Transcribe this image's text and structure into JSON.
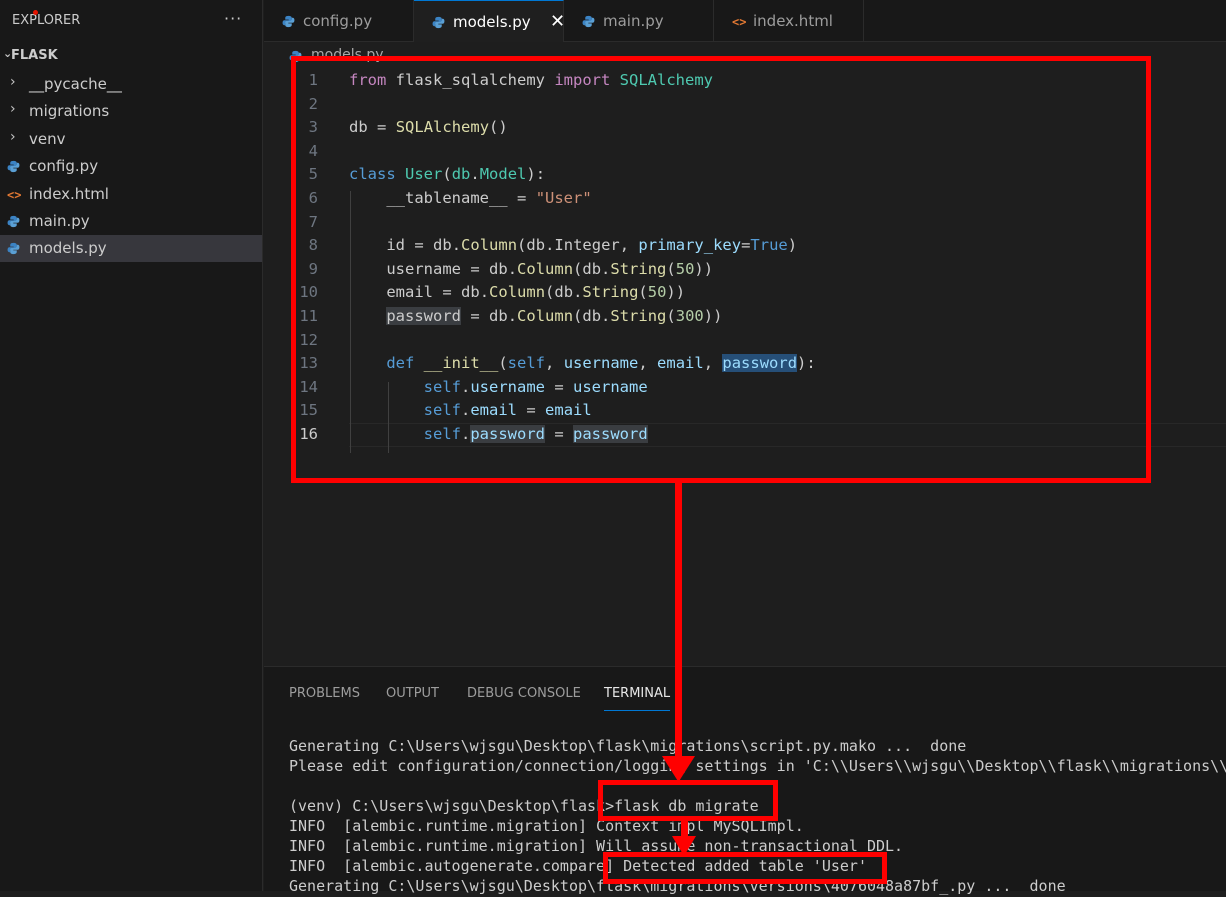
{
  "sidebar": {
    "title": "EXPLORER",
    "more": "···",
    "root_chevron": "⌄",
    "root": "FLASK",
    "items": [
      {
        "label": "__pycache__",
        "type": "folder",
        "icon": "chevron-right-icon",
        "glyph": "›"
      },
      {
        "label": "migrations",
        "type": "folder",
        "icon": "chevron-right-icon",
        "glyph": "›"
      },
      {
        "label": "venv",
        "type": "folder",
        "icon": "chevron-right-icon",
        "glyph": "›"
      },
      {
        "label": "config.py",
        "type": "file",
        "icon": "python-file-icon"
      },
      {
        "label": "index.html",
        "type": "file",
        "icon": "html-file-icon",
        "glyph": "<>"
      },
      {
        "label": "main.py",
        "type": "file",
        "icon": "python-file-icon"
      },
      {
        "label": "models.py",
        "type": "file",
        "icon": "python-file-icon",
        "selected": true
      }
    ]
  },
  "tabs": [
    {
      "label": "config.py",
      "icon": "python-file-icon",
      "active": false
    },
    {
      "label": "models.py",
      "icon": "python-file-icon",
      "active": true,
      "close": "✕"
    },
    {
      "label": "main.py",
      "icon": "python-file-icon",
      "active": false
    },
    {
      "label": "index.html",
      "icon": "html-file-icon",
      "glyph": "<>",
      "active": false
    }
  ],
  "breadcrumb": "models.py",
  "editor": {
    "current_line": 16,
    "lines": [
      {
        "n": "1",
        "text": "from flask_sqlalchemy import SQLAlchemy"
      },
      {
        "n": "2",
        "text": ""
      },
      {
        "n": "3",
        "text": "db = SQLAlchemy()"
      },
      {
        "n": "4",
        "text": ""
      },
      {
        "n": "5",
        "text": "class User(db.Model):"
      },
      {
        "n": "6",
        "text": "    __tablename__ = \"User\""
      },
      {
        "n": "7",
        "text": ""
      },
      {
        "n": "8",
        "text": "    id = db.Column(db.Integer, primary_key=True)"
      },
      {
        "n": "9",
        "text": "    username = db.Column(db.String(50))"
      },
      {
        "n": "10",
        "text": "    email = db.Column(db.String(50))"
      },
      {
        "n": "11",
        "text": "    password = db.Column(db.String(300))"
      },
      {
        "n": "12",
        "text": ""
      },
      {
        "n": "13",
        "text": "    def __init__(self, username, email, password):"
      },
      {
        "n": "14",
        "text": "        self.username = username"
      },
      {
        "n": "15",
        "text": "        self.email = email"
      },
      {
        "n": "16",
        "text": "        self.password = password"
      }
    ]
  },
  "panel": {
    "tabs": [
      "PROBLEMS",
      "OUTPUT",
      "DEBUG CONSOLE",
      "TERMINAL"
    ],
    "active_tab": "TERMINAL",
    "terminal_lines": [
      "Generating C:\\Users\\wjsgu\\Desktop\\flask\\migrations\\script.py.mako ...  done",
      "Please edit configuration/connection/logging settings in 'C:\\\\Users\\\\wjsgu\\\\Desktop\\\\flask\\\\migrations\\\\",
      "",
      "(venv) C:\\Users\\wjsgu\\Desktop\\flask>flask db migrate",
      "INFO  [alembic.runtime.migration] Context impl MySQLImpl.",
      "INFO  [alembic.runtime.migration] Will assume non-transactional DDL.",
      "INFO  [alembic.autogenerate.compare] Detected added table 'User'",
      "Generating C:\\Users\\wjsgu\\Desktop\\flask\\migrations\\versions\\4076048a87bf_.py ...  done"
    ]
  },
  "colors": {
    "annotation": "#ff0000",
    "accent": "#0078d4"
  }
}
